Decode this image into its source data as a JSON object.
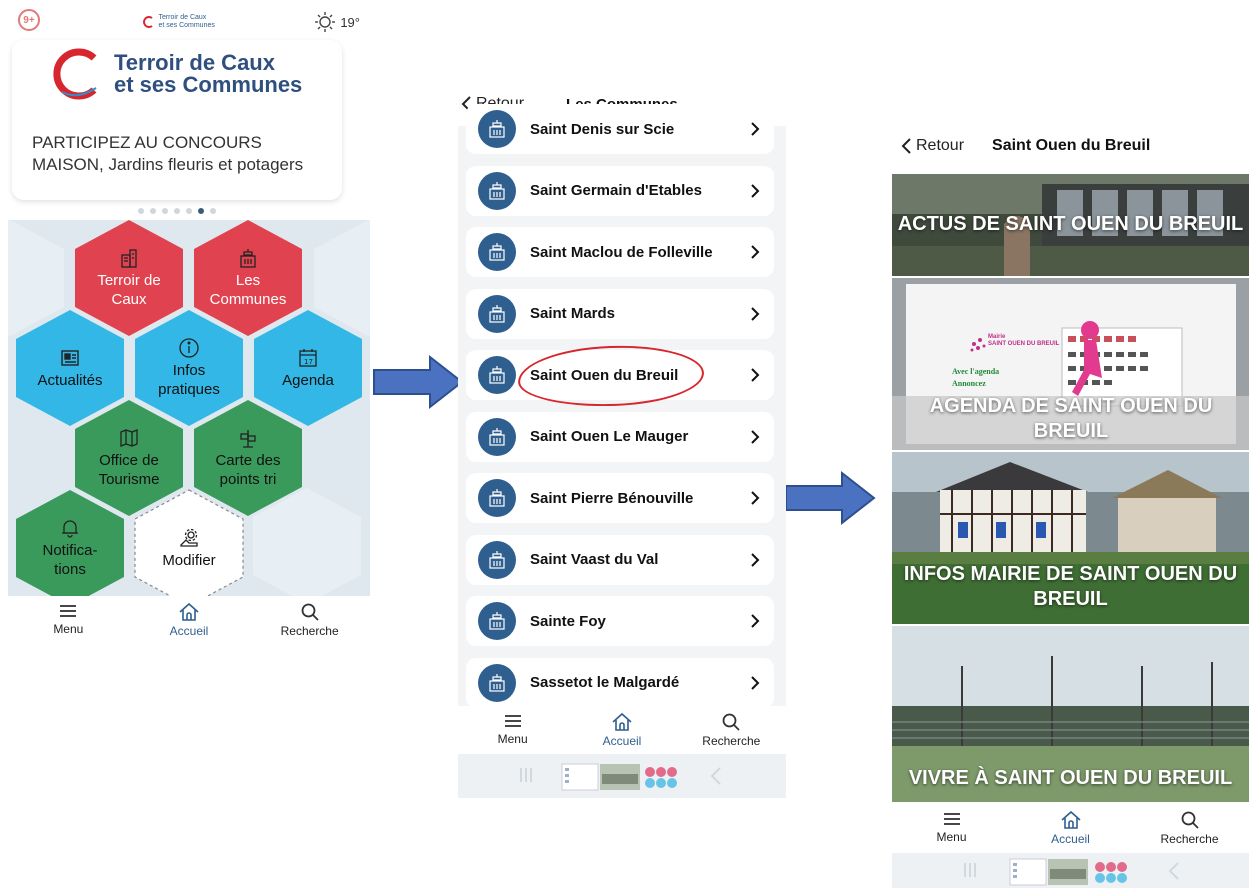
{
  "phone1": {
    "status": {
      "badge": "9+",
      "mini_logo_line1": "Terroir de Caux",
      "mini_logo_line2": "et ses Communes",
      "temperature": "19°"
    },
    "brand": {
      "line1": "Terroir de Caux",
      "line2": "et ses Communes"
    },
    "news_text": "PARTICIPEZ AU CONCOURS MAISON, Jardins fleuris et potagers",
    "carousel": {
      "count": 7,
      "active_index": 5
    },
    "tiles": [
      {
        "id": "terroir",
        "label": "Terroir de Caux",
        "icon": "buildings-icon",
        "color": "#e0434f"
      },
      {
        "id": "communes",
        "label": "Les Communes",
        "icon": "town-hall-icon",
        "color": "#e0434f"
      },
      {
        "id": "actualites",
        "label": "Actualités",
        "icon": "newspaper-icon",
        "color": "#33b7e6"
      },
      {
        "id": "infos",
        "label": "Infos pratiques",
        "icon": "info-icon",
        "color": "#33b7e6"
      },
      {
        "id": "agenda",
        "label": "Agenda",
        "icon": "calendar-icon",
        "color": "#33b7e6"
      },
      {
        "id": "tourisme",
        "label": "Office de Tourisme",
        "icon": "map-icon",
        "color": "#3a9a5c"
      },
      {
        "id": "tri",
        "label": "Carte des points tri",
        "icon": "sign-icon",
        "color": "#3a9a5c"
      },
      {
        "id": "notifications",
        "label": "Notifica-tions",
        "icon": "bell-icon",
        "color": "#3a9a5c"
      },
      {
        "id": "modifier",
        "label": "Modifier",
        "icon": "settings-icon",
        "color": "#ffffff"
      }
    ],
    "tabbar": {
      "menu": "Menu",
      "home": "Accueil",
      "search": "Recherche"
    }
  },
  "phone2": {
    "nav": {
      "back": "Retour",
      "title": "Les Communes"
    },
    "communes": [
      "Saint Denis sur Scie",
      "Saint Germain d'Etables",
      "Saint Maclou de Folleville",
      "Saint Mards",
      "Saint Ouen du Breuil",
      "Saint Ouen Le Mauger",
      "Saint Pierre Bénouville",
      "Saint Vaast du Val",
      "Sainte Foy",
      "Sassetot le Malgardé"
    ],
    "highlighted": "Saint Ouen du Breuil",
    "tabbar": {
      "menu": "Menu",
      "home": "Accueil",
      "search": "Recherche"
    }
  },
  "phone3": {
    "nav": {
      "back": "Retour",
      "title": "Saint Ouen du Breuil"
    },
    "tiles": [
      {
        "id": "actus",
        "label": "ACTUS DE SAINT OUEN DU BREUIL"
      },
      {
        "id": "agenda",
        "label": "AGENDA DE SAINT OUEN DU BREUIL",
        "flyer": {
          "org_line1": "Mairie",
          "org_line2": "SAINT OUEN DU BREUIL",
          "text1": "Avec l'agenda",
          "text2": "Annoncez"
        }
      },
      {
        "id": "infos",
        "label": "INFOS MAIRIE DE SAINT OUEN DU BREUIL"
      },
      {
        "id": "vivre",
        "label": "VIVRE À SAINT OUEN DU BREUIL"
      }
    ],
    "tabbar": {
      "menu": "Menu",
      "home": "Accueil",
      "search": "Recherche"
    }
  },
  "colors": {
    "accent": "#2f5f8f",
    "arrow": "#4a72c0",
    "highlight_circle": "#d7262d"
  }
}
